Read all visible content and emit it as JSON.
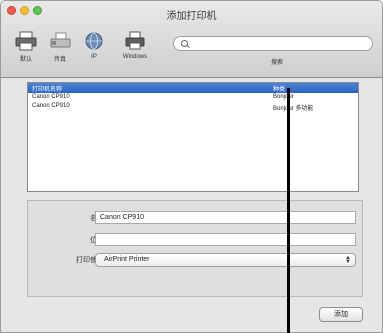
{
  "window": {
    "title": "添加打印机"
  },
  "toolbar": {
    "items": [
      {
        "label": "默认",
        "icon": "printer-icon"
      },
      {
        "label": "传真",
        "icon": "fax-icon"
      },
      {
        "label": "IP",
        "icon": "globe-icon"
      },
      {
        "label": "Windows",
        "icon": "windows-printer-icon"
      }
    ]
  },
  "search": {
    "placeholder": "",
    "caption": "搜索"
  },
  "list": {
    "headers": {
      "name": "打印机名称",
      "kind": "种类"
    },
    "rows": [
      {
        "name": "Canon CP910",
        "kind": "Bonjour"
      },
      {
        "name": "Canon CP910",
        "kind": "Bonjour 多功能"
      }
    ]
  },
  "form": {
    "name_label": "名称:",
    "name_value": "Canon CP910",
    "location_label": "位置:",
    "location_value": "",
    "use_label": "打印使用:",
    "use_value": "AirPrint Printer"
  },
  "buttons": {
    "add": "添加"
  },
  "colors": {
    "selection": "#3d74d2",
    "header": "#2d63bf"
  }
}
